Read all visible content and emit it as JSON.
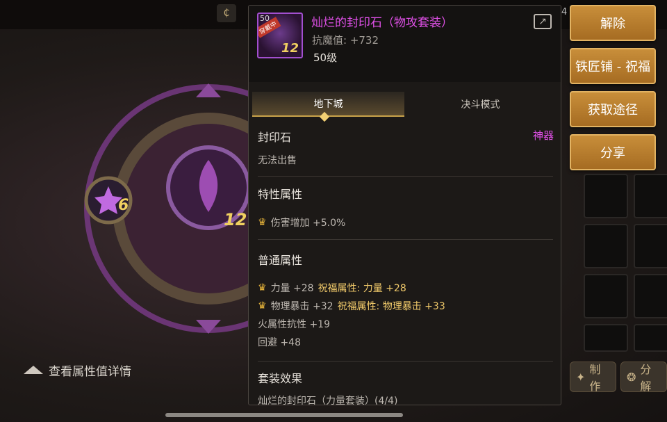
{
  "top": {
    "number": "4"
  },
  "left": {
    "small_gem_plus": "6",
    "big_gem_plus": "12",
    "detail_toggle_label": "查看属性值详情"
  },
  "actions": [
    "解除",
    "铁匠铺 - 祝福",
    "获取途径",
    "分享"
  ],
  "bottom_buttons": [
    {
      "label": "制作",
      "icon": "craft-icon"
    },
    {
      "label": "分解",
      "icon": "disassemble-icon"
    }
  ],
  "tooltip": {
    "icon_level": "50",
    "icon_badge": "穿戴中",
    "icon_plus": "12",
    "item_name": "灿烂的封印石（物攻套装）",
    "resist": "抗魔值: +732",
    "level": "50级",
    "tabs": [
      "地下城",
      "决斗模式"
    ],
    "category": "封印石",
    "rarity": "神器",
    "sell_status": "无法出售",
    "special_title": "特性属性",
    "special_stats": [
      {
        "text": "伤害增加 +5.0%"
      }
    ],
    "normal_title": "普通属性",
    "normal_stats": [
      {
        "text": "力量 +28",
        "bless": "祝福属性: 力量 +28",
        "crown": true
      },
      {
        "text": "物理暴击 +32",
        "bless": "祝福属性: 物理暴击 +33",
        "crown": true
      },
      {
        "text": "火属性抗性 +19",
        "bless": "",
        "crown": false
      },
      {
        "text": "回避 +48",
        "bless": "",
        "crown": false
      }
    ],
    "set_title": "套装效果",
    "set_line": "灿烂的封印石（力量套装）(4/4)"
  },
  "colors": {
    "epic_purple": "#e050e8",
    "action_orange": "#b9782a",
    "bless_gold": "#f0c96a"
  }
}
